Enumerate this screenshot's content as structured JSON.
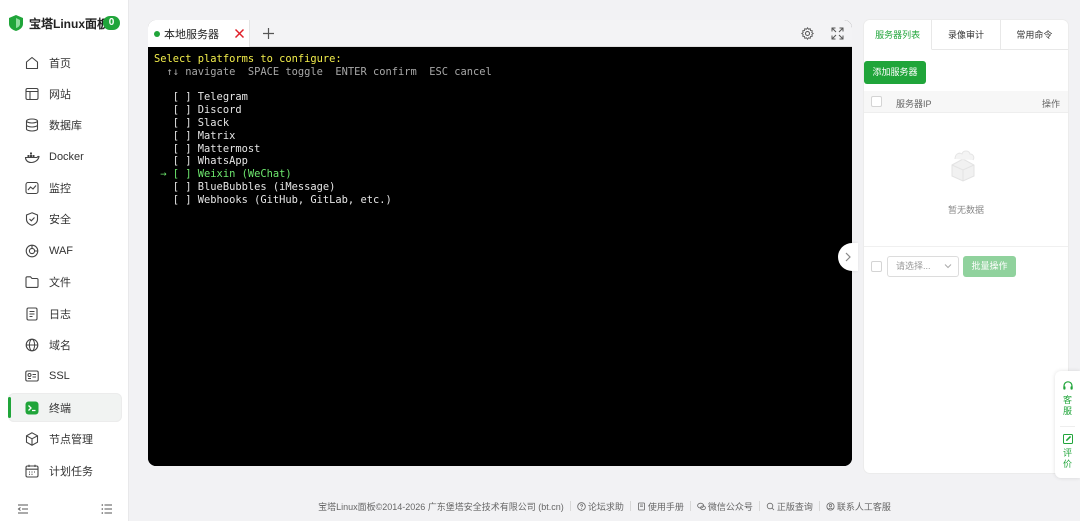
{
  "brand": {
    "name": "宝塔Linux面板",
    "badge": "0",
    "accent": "#20a53a"
  },
  "sidebar": {
    "items": [
      {
        "label": "首页",
        "icon": "home-icon"
      },
      {
        "label": "网站",
        "icon": "website-icon"
      },
      {
        "label": "数据库",
        "icon": "database-icon"
      },
      {
        "label": "Docker",
        "icon": "docker-icon"
      },
      {
        "label": "监控",
        "icon": "monitor-icon"
      },
      {
        "label": "安全",
        "icon": "shield-icon"
      },
      {
        "label": "WAF",
        "icon": "waf-icon"
      },
      {
        "label": "文件",
        "icon": "folder-icon"
      },
      {
        "label": "日志",
        "icon": "log-icon"
      },
      {
        "label": "域名",
        "icon": "domain-icon"
      },
      {
        "label": "SSL",
        "icon": "ssl-icon"
      },
      {
        "label": "终端",
        "icon": "terminal-icon",
        "active": true
      },
      {
        "label": "节点管理",
        "icon": "node-icon"
      },
      {
        "label": "计划任务",
        "icon": "calendar-icon"
      }
    ]
  },
  "terminal": {
    "tab_label": "本地服务器",
    "lines": [
      {
        "text": "Select platforms to configure:",
        "style": "yellow"
      },
      {
        "text": "  ↑↓ navigate  SPACE toggle  ENTER confirm  ESC cancel",
        "style": "gray"
      },
      {
        "text": "",
        "style": "spacer"
      },
      {
        "text": "   [ ] Telegram",
        "style": "white"
      },
      {
        "text": "   [ ] Discord",
        "style": "white"
      },
      {
        "text": "   [ ] Slack",
        "style": "white"
      },
      {
        "text": "   [ ] Matrix",
        "style": "white"
      },
      {
        "text": "   [ ] Mattermost",
        "style": "white"
      },
      {
        "text": "   [ ] WhatsApp",
        "style": "white"
      },
      {
        "text": " → [ ] Weixin (WeChat)",
        "style": "green"
      },
      {
        "text": "   [ ] BlueBubbles (iMessage)",
        "style": "white"
      },
      {
        "text": "   [ ] Webhooks (GitHub, GitLab, etc.)",
        "style": "white"
      }
    ]
  },
  "right_panel": {
    "tabs": [
      {
        "label": "服务器列表",
        "active": true
      },
      {
        "label": "录像审计"
      },
      {
        "label": "常用命令"
      }
    ],
    "add_button": "添加服务器",
    "table": {
      "col_ip": "服务器IP",
      "col_op": "操作"
    },
    "empty_text": "暂无数据",
    "select_placeholder": "请选择...",
    "batch_button": "批量操作"
  },
  "float_bar": {
    "service": "客服",
    "review": "评价"
  },
  "footer": {
    "copyright": "宝塔Linux面板©2014-2026 广东堡塔安全技术有限公司 (bt.cn)",
    "links": [
      "论坛求助",
      "使用手册",
      "微信公众号",
      "正版查询",
      "联系人工客服"
    ]
  }
}
